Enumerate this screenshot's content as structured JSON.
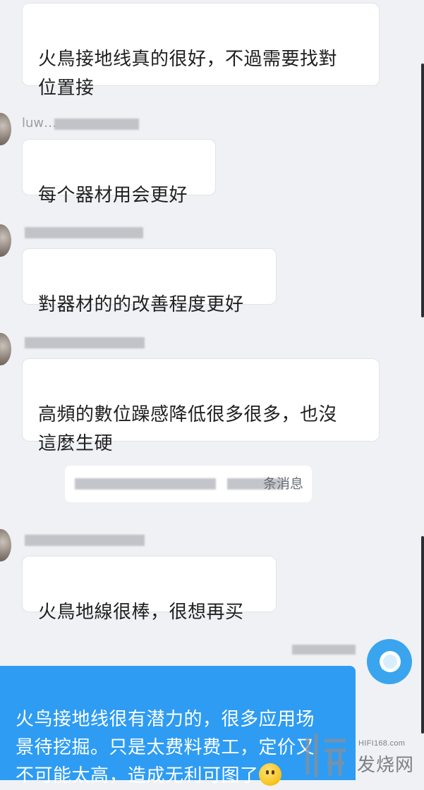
{
  "messages": [
    {
      "text": "火鳥接地线真的很好，不過需要找對\n位置接"
    },
    {
      "sender": "luw…",
      "text": "每个器材用会更好"
    },
    {
      "sender": "",
      "text": "對器材的的改善程度更好"
    },
    {
      "sender": "",
      "text": "高頻的數位躁感降低很多很多，也沒\n這麼生硬"
    },
    {
      "sender": "",
      "text": "火鳥地線很棒，很想再买"
    }
  ],
  "notice": {
    "text": "条消息"
  },
  "own_message": {
    "text": "火鸟接地线很有潜力的，很多应用场\n景待挖掘。只是太费料费工，定价又\n不可能太高，造成无利可图了"
  },
  "watermark": {
    "domain": "HIFI168.com",
    "name": "发烧网"
  },
  "colors": {
    "background": "#eff1f4",
    "own_bubble": "#2e9cf2",
    "bubble": "#ffffff"
  }
}
